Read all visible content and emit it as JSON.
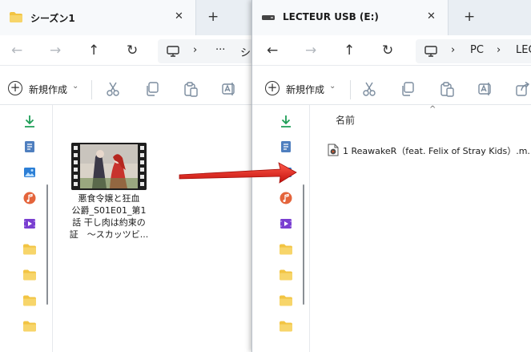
{
  "left_window": {
    "tab_title": "シーズン1",
    "close_glyph": "✕",
    "newtab_glyph": "+",
    "nav": {
      "back": "←",
      "forward": "→",
      "up": "↑",
      "refresh": "↻"
    },
    "address": {
      "chevron": "›",
      "ellipsis": "···",
      "crumb_partial": "シー"
    },
    "commands": {
      "new_label": "新規作成",
      "new_chevron": "⌄"
    },
    "file_tile": {
      "name_lines": [
        "悪食令嬢と狂血",
        "公爵_S01E01_第1",
        "話 干し肉は約束の",
        "証　〜スカッツビ..."
      ]
    }
  },
  "right_window": {
    "tab_title": "LECTEUR USB (E:)",
    "close_glyph": "✕",
    "newtab_glyph": "+",
    "nav": {
      "back": "←",
      "forward": "→",
      "up": "↑",
      "refresh": "↻"
    },
    "address": {
      "chevron1": "›",
      "pc": "PC",
      "chevron2": "›",
      "crumb_partial": "LEC"
    },
    "commands": {
      "new_label": "新規作成",
      "new_chevron": "⌄"
    },
    "list": {
      "column_name": "名前",
      "sort_glyph": "^",
      "files": [
        {
          "name": "1 ReawakeR（feat. Felix of Stray Kids）.m..."
        }
      ]
    }
  },
  "colors": {
    "folder": "#f2c443",
    "download": "#1f9e57",
    "arrow_red": "#e3201b"
  },
  "icons": [
    "folder-icon",
    "download-icon",
    "documents-icon",
    "pictures-icon",
    "music-icon",
    "videos-icon",
    "cut-icon",
    "copy-icon",
    "paste-icon",
    "rename-icon",
    "share-icon",
    "monitor-icon"
  ]
}
